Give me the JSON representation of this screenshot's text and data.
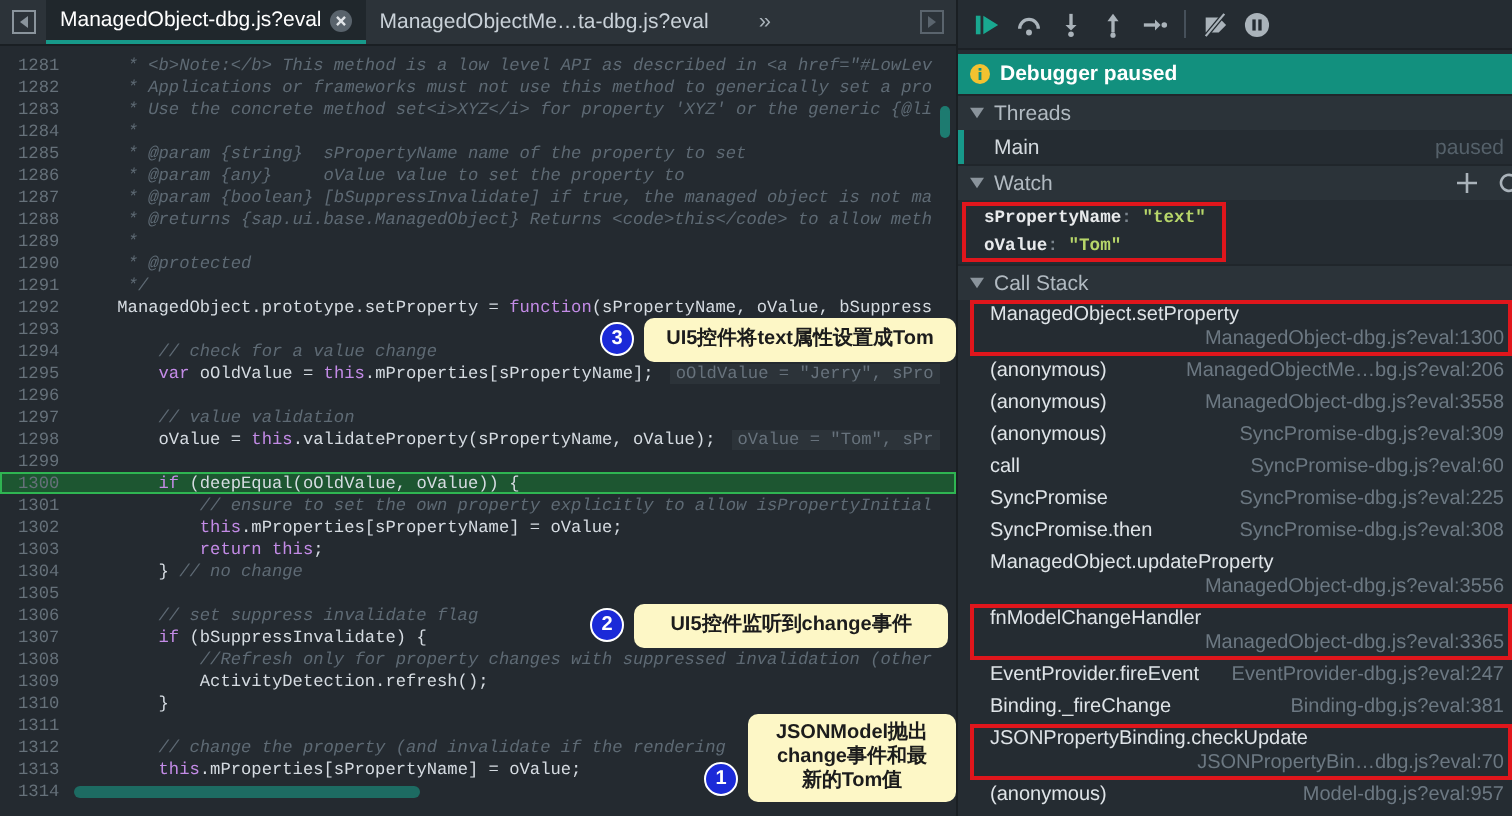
{
  "editor": {
    "tabs": [
      {
        "label": "ManagedObject-dbg.js?eval",
        "selected": true,
        "closable": true
      },
      {
        "label": "ManagedObjectMe…ta-dbg.js?eval",
        "selected": false,
        "closable": false
      }
    ],
    "overflow": "»",
    "lines": [
      {
        "n": "1281",
        "current": false,
        "segments": [
          {
            "kind": "comment",
            "t": "     * <b>Note:</b> This method is a low level API as described in <a href=\"#LowLev"
          }
        ]
      },
      {
        "n": "1282",
        "current": false,
        "segments": [
          {
            "kind": "comment",
            "t": "     * Applications or frameworks must not use this method to generically set a pro"
          }
        ]
      },
      {
        "n": "1283",
        "current": false,
        "segments": [
          {
            "kind": "comment",
            "t": "     * Use the concrete method set<i>XYZ</i> for property 'XYZ' or the generic {@li"
          }
        ]
      },
      {
        "n": "1284",
        "current": false,
        "segments": [
          {
            "kind": "comment",
            "t": "     *"
          }
        ]
      },
      {
        "n": "1285",
        "current": false,
        "segments": [
          {
            "kind": "comment",
            "t": "     * @param {string}  sPropertyName name of the property to set"
          }
        ]
      },
      {
        "n": "1286",
        "current": false,
        "segments": [
          {
            "kind": "comment",
            "t": "     * @param {any}     oValue value to set the property to"
          }
        ]
      },
      {
        "n": "1287",
        "current": false,
        "segments": [
          {
            "kind": "comment",
            "t": "     * @param {boolean} [bSuppressInvalidate] if true, the managed object is not ma"
          }
        ]
      },
      {
        "n": "1288",
        "current": false,
        "segments": [
          {
            "kind": "comment",
            "t": "     * @returns {sap.ui.base.ManagedObject} Returns <code>this</code> to allow meth"
          }
        ]
      },
      {
        "n": "1289",
        "current": false,
        "segments": [
          {
            "kind": "comment",
            "t": "     *"
          }
        ]
      },
      {
        "n": "1290",
        "current": false,
        "segments": [
          {
            "kind": "comment",
            "t": "     * @protected"
          }
        ]
      },
      {
        "n": "1291",
        "current": false,
        "segments": [
          {
            "kind": "comment",
            "t": "     */"
          }
        ]
      },
      {
        "n": "1292",
        "current": false,
        "segments": [
          {
            "kind": "identifier",
            "t": "    ManagedObject.prototype.setProperty = "
          },
          {
            "kind": "keyword",
            "t": "function"
          },
          {
            "kind": "identifier",
            "t": "(sPropertyName, oValue, bSuppress"
          }
        ]
      },
      {
        "n": "1293",
        "current": false,
        "callout": {
          "number": "3",
          "text": "UI5控件将text属性设置成Tom"
        }
      },
      {
        "n": "1294",
        "current": false,
        "segments": [
          {
            "kind": "comment",
            "t": "        // check for a value change"
          }
        ]
      },
      {
        "n": "1295",
        "current": false,
        "segments": [
          {
            "kind": "keyword",
            "t": "        var"
          },
          {
            "kind": "identifier",
            "t": " oOldValue = "
          },
          {
            "kind": "keyword",
            "t": "this"
          },
          {
            "kind": "identifier",
            "t": ".mProperties[sPropertyName];"
          }
        ],
        "inline_value": "oOldValue = \"Jerry\", sPro"
      },
      {
        "n": "1296",
        "current": false
      },
      {
        "n": "1297",
        "current": false,
        "segments": [
          {
            "kind": "comment",
            "t": "        // value validation"
          }
        ]
      },
      {
        "n": "1298",
        "current": false,
        "segments": [
          {
            "kind": "identifier",
            "t": "        oValue = "
          },
          {
            "kind": "keyword",
            "t": "this"
          },
          {
            "kind": "identifier",
            "t": ".validateProperty(sPropertyName, oValue);"
          }
        ],
        "inline_value": "oValue = \"Tom\", sPr"
      },
      {
        "n": "1299",
        "current": false
      },
      {
        "n": "1300",
        "current": true,
        "segments": [
          {
            "kind": "keyword",
            "t": "        if"
          },
          {
            "kind": "identifier",
            "t": " (deepEqual(oOldValue, oValue)) {"
          }
        ]
      },
      {
        "n": "1301",
        "current": false,
        "segments": [
          {
            "kind": "comment",
            "t": "            // ensure to set the own property explicitly to allow isPropertyInitial"
          }
        ]
      },
      {
        "n": "1302",
        "current": false,
        "segments": [
          {
            "kind": "keyword",
            "t": "            this"
          },
          {
            "kind": "identifier",
            "t": ".mProperties[sPropertyName] = oValue;"
          }
        ]
      },
      {
        "n": "1303",
        "current": false,
        "segments": [
          {
            "kind": "keyword",
            "t": "            return this"
          },
          {
            "kind": "identifier",
            "t": ";"
          }
        ]
      },
      {
        "n": "1304",
        "current": false,
        "segments": [
          {
            "kind": "identifier",
            "t": "        } "
          },
          {
            "kind": "comment",
            "t": "// no change"
          }
        ]
      },
      {
        "n": "1305",
        "current": false
      },
      {
        "n": "1306",
        "current": false,
        "segments": [
          {
            "kind": "comment",
            "t": "        // set suppress invalidate flag"
          }
        ],
        "callout": {
          "number": "2",
          "text": "UI5控件监听到change事件"
        }
      },
      {
        "n": "1307",
        "current": false,
        "segments": [
          {
            "kind": "keyword",
            "t": "        if"
          },
          {
            "kind": "identifier",
            "t": " (bSuppressInvalidate) {"
          }
        ]
      },
      {
        "n": "1308",
        "current": false,
        "segments": [
          {
            "kind": "comment",
            "t": "            //Refresh only for property changes with suppressed invalidation (other"
          }
        ]
      },
      {
        "n": "1309",
        "current": false,
        "segments": [
          {
            "kind": "identifier",
            "t": "            ActivityDetection.refresh();"
          }
        ]
      },
      {
        "n": "1310",
        "current": false,
        "segments": [
          {
            "kind": "identifier",
            "t": "        }"
          }
        ]
      },
      {
        "n": "1311",
        "current": false,
        "callout": {
          "number": "1",
          "text": "JSONModel抛出change事件和最新的Tom值"
        }
      },
      {
        "n": "1312",
        "current": false,
        "segments": [
          {
            "kind": "comment",
            "t": "        // change the property (and invalidate if the rendering"
          }
        ]
      },
      {
        "n": "1313",
        "current": false,
        "segments": [
          {
            "kind": "keyword",
            "t": "        this"
          },
          {
            "kind": "identifier",
            "t": ".mProperties[sPropertyName] = oValue;"
          }
        ]
      },
      {
        "n": "1314",
        "current": false
      }
    ]
  },
  "debugger": {
    "banner": "Debugger paused",
    "threads": {
      "title": "Threads",
      "expanded": true,
      "items": [
        {
          "name": "Main",
          "status": "paused",
          "selected": true
        }
      ]
    },
    "watch": {
      "title": "Watch",
      "expanded": true,
      "highlighted": true,
      "items": [
        {
          "name": "sPropertyName",
          "sep": ":",
          "value": "\"text\""
        },
        {
          "name": "oValue",
          "sep": ":",
          "value": "\"Tom\""
        }
      ]
    },
    "call_stack": {
      "title": "Call Stack",
      "expanded": true,
      "frames": [
        {
          "name": "ManagedObject.setProperty",
          "location": "ManagedObject-dbg.js?eval:1300",
          "highlighted": true
        },
        {
          "name": "(anonymous)",
          "location": "ManagedObjectMe…bg.js?eval:206",
          "highlighted": false
        },
        {
          "name": "(anonymous)",
          "location": "ManagedObject-dbg.js?eval:3558",
          "highlighted": false
        },
        {
          "name": "(anonymous)",
          "location": "SyncPromise-dbg.js?eval:309",
          "highlighted": false
        },
        {
          "name": "call",
          "location": "SyncPromise-dbg.js?eval:60",
          "highlighted": false
        },
        {
          "name": "SyncPromise",
          "location": "SyncPromise-dbg.js?eval:225",
          "highlighted": false
        },
        {
          "name": "SyncPromise.then",
          "location": "SyncPromise-dbg.js?eval:308",
          "highlighted": false
        },
        {
          "name": "ManagedObject.updateProperty",
          "location": "ManagedObject-dbg.js?eval:3556",
          "highlighted": false
        },
        {
          "name": "fnModelChangeHandler",
          "location": "ManagedObject-dbg.js?eval:3365",
          "highlighted": true
        },
        {
          "name": "EventProvider.fireEvent",
          "location": "EventProvider-dbg.js?eval:247",
          "highlighted": false
        },
        {
          "name": "Binding._fireChange",
          "location": "Binding-dbg.js?eval:381",
          "highlighted": false
        },
        {
          "name": "JSONPropertyBinding.checkUpdate",
          "location": "JSONPropertyBin…dbg.js?eval:70",
          "highlighted": true
        },
        {
          "name": "(anonymous)",
          "location": "Model-dbg.js?eval:957",
          "highlighted": false
        }
      ]
    }
  }
}
